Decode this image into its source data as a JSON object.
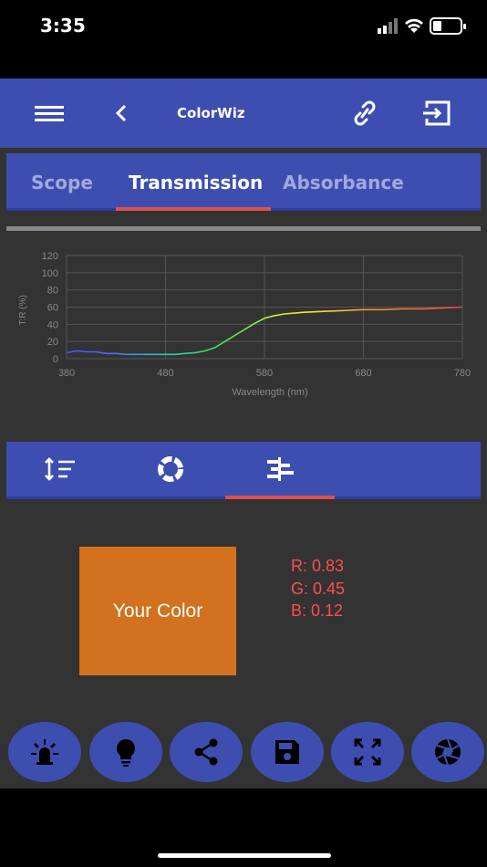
{
  "status": {
    "time": "3:35"
  },
  "header": {
    "title": "ColorWiz"
  },
  "tabs": [
    {
      "label": "Scope"
    },
    {
      "label": "Transmission"
    },
    {
      "label": "Absorbance"
    }
  ],
  "chart_data": {
    "type": "line",
    "title": "",
    "xlabel": "Wavelength (nm)",
    "ylabel": "T:R (%)",
    "xlim": [
      380,
      780
    ],
    "ylim": [
      0,
      120
    ],
    "x_ticks": [
      "380",
      "480",
      "580",
      "680",
      "780"
    ],
    "y_ticks": [
      "120",
      "100",
      "80",
      "60",
      "40",
      "20",
      "0"
    ],
    "grid": true,
    "series": [
      {
        "x": [
          380,
          390,
          400,
          410,
          420,
          430,
          440,
          450,
          460,
          470,
          480,
          490,
          500,
          510,
          520,
          530,
          540,
          550,
          560,
          570,
          580,
          590,
          600,
          620,
          640,
          660,
          680,
          700,
          720,
          740,
          760,
          780
        ],
        "values": [
          7,
          9,
          8,
          8,
          6,
          6,
          5,
          5,
          5,
          5,
          5,
          5,
          6,
          7,
          9,
          13,
          20,
          27,
          34,
          41,
          47,
          50,
          52,
          54,
          55,
          56,
          57,
          57,
          58,
          58,
          59,
          60
        ],
        "color": "spectral-gradient"
      }
    ]
  },
  "swatch": {
    "label": "Your Color",
    "color": "#d2721e"
  },
  "rgb": {
    "r": "R: 0.83",
    "g": "G: 0.45",
    "b": "B: 0.12"
  },
  "colors": {
    "bar": "#3d4eb0",
    "background": "#333333",
    "accent": "#e05050",
    "rgb_text": "#ff4d4d"
  },
  "bottom_actions": [
    "light-source-icon",
    "bulb-icon",
    "share-icon",
    "save-icon",
    "fullscreen-icon",
    "camera-aperture-icon"
  ]
}
